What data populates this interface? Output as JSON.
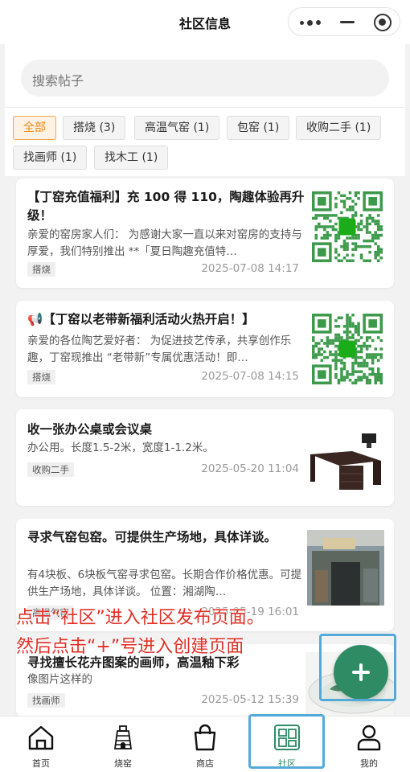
{
  "header": {
    "title": "社区信息"
  },
  "search": {
    "placeholder": "搜索帖子"
  },
  "filters": [
    {
      "label": "全部",
      "active": true
    },
    {
      "label": "搭烧 (3)"
    },
    {
      "label": "高温气窑 (1)"
    },
    {
      "label": "包窑 (1)"
    },
    {
      "label": "收购二手 (1)"
    },
    {
      "label": "找画师 (1)"
    },
    {
      "label": "找木工 (1)"
    }
  ],
  "posts": [
    {
      "title": "【丁窑充值福利】充 100 得 110，陶趣体验再升级！",
      "body": "亲爱的窑房家人们： 为感谢大家一直以来对窑房的支持与厚爱，我们特别推出 **「夏日陶趣充值特…",
      "category": "搭烧",
      "date": "2025-07-08 14:17",
      "image": "qr-code"
    },
    {
      "title": "📢【丁窑以老带新福利活动火热开启！】",
      "body": "亲爱的各位陶艺爱好者： 为促进技艺传承，共享创作乐趣，丁窑现推出 “老带新”专属优惠活动！即…",
      "category": "搭烧",
      "date": "2025-07-08 14:15",
      "image": "qr-code"
    },
    {
      "title": "收一张办公桌或会议桌",
      "body": "办公用。长度1.5-2米，宽度1-1.2米。",
      "category": "收购二手",
      "date": "2025-05-20 11:04",
      "image": "desk-photo"
    },
    {
      "title": "寻求气窑包窑。可提供生产场地，具体详谈。",
      "body": "有4块板、6块板气窑寻求包窑。长期合作价格优惠。可提供生产场地，具体详谈。 位置：湘湖陶…",
      "category": "高温气窑",
      "date": "2025-05-19 16:01",
      "image": "kiln-photo"
    },
    {
      "title": "寻找擅长花卉图案的画师，高温釉下彩",
      "body": "像图片这样的",
      "category": "找画师",
      "date": "2025-05-12 15:39",
      "image": "plate-photo"
    }
  ],
  "overlay": {
    "line1": "点击“社区”进入社区发布页面。",
    "line2": "然后点击“+”号进入创建页面"
  },
  "nav": [
    {
      "label": "首页",
      "icon": "home-icon"
    },
    {
      "label": "烧窑",
      "icon": "kiln-icon"
    },
    {
      "label": "商店",
      "icon": "shopping-bag-icon"
    },
    {
      "label": "社区",
      "icon": "community-icon",
      "active": true
    },
    {
      "label": "我的",
      "icon": "user-icon"
    }
  ],
  "colors": {
    "accent": "#2e8b64",
    "filter_active": "#ee8b16",
    "annotation": "#e03027",
    "highlight": "#55a9d9"
  }
}
